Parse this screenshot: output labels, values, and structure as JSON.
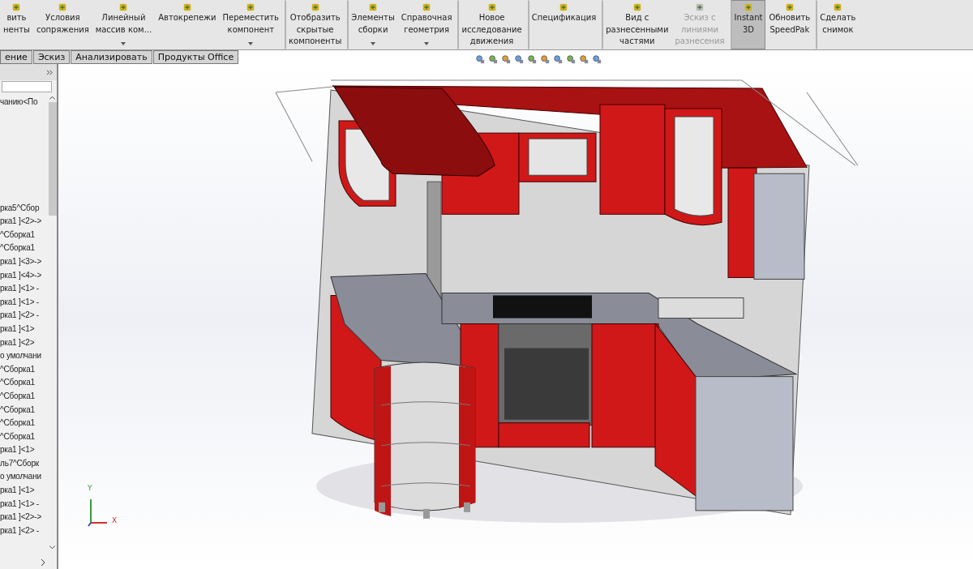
{
  "toolbar": {
    "buttons": [
      {
        "label": "вить\nненты",
        "dropdown": false,
        "disabled": false,
        "selected": false,
        "separator_before": false
      },
      {
        "label": "Условия\nсопряжения",
        "dropdown": false,
        "disabled": false,
        "selected": false,
        "separator_before": false
      },
      {
        "label": "Линейный\nмассив ком...",
        "dropdown": true,
        "disabled": false,
        "selected": false,
        "separator_before": false
      },
      {
        "label": "Автокрепежи",
        "dropdown": false,
        "disabled": false,
        "selected": false,
        "separator_before": false
      },
      {
        "label": "Переместить\nкомпонент",
        "dropdown": true,
        "disabled": false,
        "selected": false,
        "separator_before": false
      },
      {
        "label": "Отобразить\nскрытые\nкомпоненты",
        "dropdown": false,
        "disabled": false,
        "selected": false,
        "separator_before": true
      },
      {
        "label": "Элементы\nсборки",
        "dropdown": true,
        "disabled": false,
        "selected": false,
        "separator_before": true
      },
      {
        "label": "Справочная\nгеометрия",
        "dropdown": true,
        "disabled": false,
        "selected": false,
        "separator_before": false
      },
      {
        "label": "Новое\nисследование\nдвижения",
        "dropdown": false,
        "disabled": false,
        "selected": false,
        "separator_before": true
      },
      {
        "label": "Спецификация",
        "dropdown": false,
        "disabled": false,
        "selected": false,
        "separator_before": true
      },
      {
        "label": "Вид с\nразнесенными\nчастями",
        "dropdown": false,
        "disabled": false,
        "selected": false,
        "separator_before": true
      },
      {
        "label": "Эскиз с\nлиниями\nразнесения",
        "dropdown": false,
        "disabled": true,
        "selected": false,
        "separator_before": false
      },
      {
        "label": "Instant\n3D",
        "dropdown": false,
        "disabled": false,
        "selected": true,
        "separator_before": true
      },
      {
        "label": "Обновить\nSpeedPak",
        "dropdown": false,
        "disabled": false,
        "selected": false,
        "separator_before": false
      },
      {
        "label": "Сделать\nснимок",
        "dropdown": false,
        "disabled": false,
        "selected": false,
        "separator_before": true
      }
    ]
  },
  "tabs": [
    {
      "label": "ение",
      "selected": false
    },
    {
      "label": "Эскиз",
      "selected": false
    },
    {
      "label": "Анализировать",
      "selected": false
    },
    {
      "label": "Продукты Office",
      "selected": false
    }
  ],
  "tree": {
    "top_item": "чанию<По",
    "items": [
      "рка5^Сбор",
      "рка1 ]<2>->",
      "^Сборка1",
      "^Сборка1",
      "рка1 ]<3>->",
      "рка1 ]<4>->",
      "рка1 ]<1> -",
      "рка1 ]<1> -",
      "рка1 ]<2> -",
      "рка1 ]<1>",
      "рка1 ]<2>",
      "о умолчани",
      "^Сборка1",
      "^Сборка1",
      "^Сборка1",
      "^Сборка1",
      "^Сборка1",
      "^Сборка1",
      "рка1 ]<1>",
      "ль7^Сборк",
      "о умолчани",
      "рка1 ]<1>",
      "рка1 ]<1> -",
      "рка1 ]<2>->",
      "рка1 ]<2> -"
    ]
  },
  "triad": {
    "y_label": "Y",
    "x_label": "X"
  }
}
